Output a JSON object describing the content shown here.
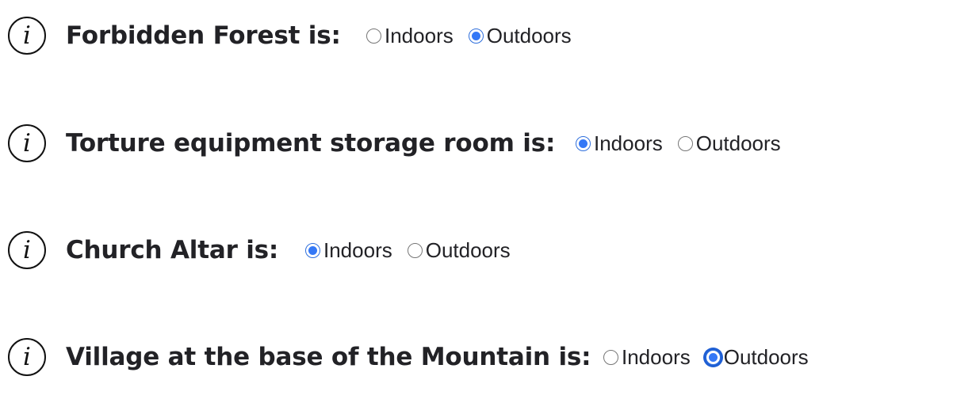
{
  "questions": [
    {
      "label": "Forbidden Forest is:",
      "selected": "Outdoors",
      "options": [
        "Indoors",
        "Outdoors"
      ],
      "info_icon": "info-icon"
    },
    {
      "label": "Torture equipment storage room is:",
      "selected": "Indoors",
      "options": [
        "Indoors",
        "Outdoors"
      ],
      "info_icon": "info-icon"
    },
    {
      "label": "Church Altar is:",
      "selected": "Indoors",
      "options": [
        "Indoors",
        "Outdoors"
      ],
      "info_icon": "info-icon"
    },
    {
      "label": "Village at the base of the Mountain is:",
      "selected": "Outdoors",
      "focused": "Outdoors",
      "options": [
        "Indoors",
        "Outdoors"
      ],
      "info_icon": "info-icon"
    }
  ],
  "info_glyph": "i",
  "colors": {
    "radio_checked": "#3478f6",
    "text": "#222226"
  }
}
